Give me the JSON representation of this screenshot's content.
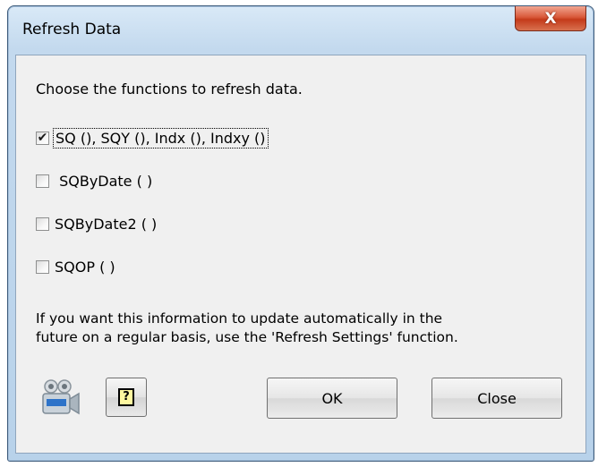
{
  "window": {
    "title": "Refresh Data",
    "close_glyph": "X"
  },
  "dialog": {
    "intro": "Choose the functions to refresh data.",
    "options": [
      {
        "label": "SQ (), SQY (), Indx (), Indxy ()",
        "checked": true,
        "check_glyph": "✔"
      },
      {
        "label": " SQByDate ( )",
        "checked": false,
        "check_glyph": ""
      },
      {
        "label": "SQByDate2 ( )",
        "checked": false,
        "check_glyph": ""
      },
      {
        "label": "SQOP ( )",
        "checked": false,
        "check_glyph": ""
      }
    ],
    "info_line1": "If you want this information to update automatically in the",
    "info_line2": "future on a regular basis, use the 'Refresh Settings' function.",
    "help_glyph": "?",
    "ok_label": "OK",
    "close_label": "Close"
  },
  "icons": {
    "camera": "video-camera-icon",
    "help": "help-icon"
  },
  "colors": {
    "title_close_red": "#c43a1a",
    "window_frame_blue": "#c3d9ee",
    "client_bg": "#f0f0f0"
  }
}
